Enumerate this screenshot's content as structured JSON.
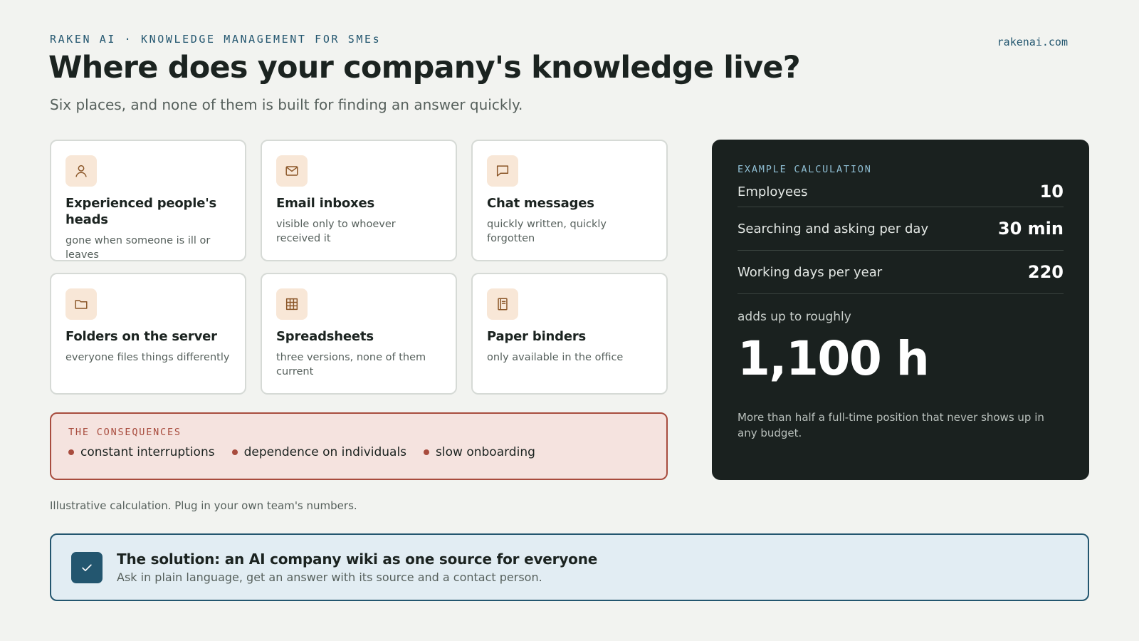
{
  "header": {
    "eyebrow": "RAKEN AI · KNOWLEDGE MANAGEMENT FOR SMEs",
    "site": "rakenai.com",
    "title": "Where does your company's knowledge live?",
    "subtitle": "Six places, and none of them is built for finding an answer quickly."
  },
  "places": [
    {
      "icon": "person-icon",
      "title": "Experienced people's heads",
      "desc": "gone when someone is ill or leaves"
    },
    {
      "icon": "mail-icon",
      "title": "Email inboxes",
      "desc": "visible only to whoever received it"
    },
    {
      "icon": "chat-icon",
      "title": "Chat messages",
      "desc": "quickly written, quickly forgotten"
    },
    {
      "icon": "folder-icon",
      "title": "Folders on the server",
      "desc": "everyone files things differently"
    },
    {
      "icon": "spreadsheet-icon",
      "title": "Spreadsheets",
      "desc": "three versions, none of them current"
    },
    {
      "icon": "binder-icon",
      "title": "Paper binders",
      "desc": "only available in the office"
    }
  ],
  "consequences": {
    "label": "THE CONSEQUENCES",
    "items": [
      "constant interruptions",
      "dependence on individuals",
      "slow onboarding"
    ]
  },
  "note": "Illustrative calculation. Plug in your own team's numbers.",
  "calculation": {
    "label": "EXAMPLE CALCULATION",
    "rows": [
      {
        "label": "Employees",
        "value": "10"
      },
      {
        "label": "Searching and asking per day",
        "value": "30 min"
      },
      {
        "label": "Working days per year",
        "value": "220"
      }
    ],
    "adds_up": "adds up to roughly",
    "total": "1,100 h",
    "footnote": "More than half a full-time position that never shows up in any budget."
  },
  "solution": {
    "icon": "check-icon",
    "title": "The solution: an AI company wiki as one source for everyone",
    "desc": "Ask in plain language, get an answer with its source and a contact person."
  },
  "colors": {
    "accent": "#23566f",
    "warning": "#a84c3e",
    "dark_panel": "#1a211f",
    "icon_bg": "#f8e7d7"
  }
}
